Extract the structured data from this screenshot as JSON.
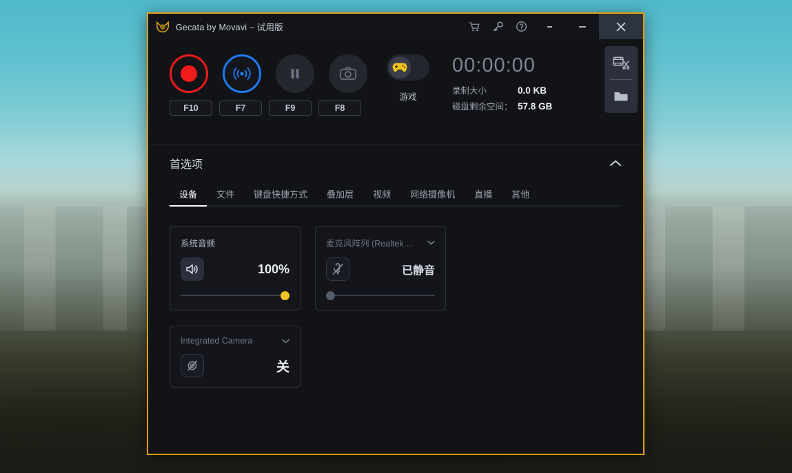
{
  "window": {
    "title": "Gecata by Movavi – 试用版",
    "logo_icon": "gecata-cat-logo-icon",
    "accent_border": "#e5a00d",
    "titlebar_icons": [
      {
        "name": "cart-icon",
        "glyph": "cart"
      },
      {
        "name": "key-icon",
        "glyph": "key"
      },
      {
        "name": "help-icon",
        "glyph": "question-circle"
      }
    ],
    "controls": {
      "collapse_to_tray_label": "-",
      "minimize_label": "—",
      "close_label": "✕"
    }
  },
  "toolbar": {
    "record": {
      "name": "record-button",
      "hotkey": "F10",
      "state": "idle",
      "color": "#f01b1b"
    },
    "stream": {
      "name": "stream-button",
      "hotkey": "F7",
      "state": "idle",
      "color": "#1b7cf5"
    },
    "pause": {
      "name": "pause-button",
      "hotkey": "F9",
      "state": "disabled"
    },
    "screenshot": {
      "name": "screenshot-button",
      "hotkey": "F8",
      "state": "disabled"
    },
    "game_toggle": {
      "label": "游戏",
      "state": "off",
      "icon": "gamepad-icon",
      "icon_color": "#f5c518"
    }
  },
  "status": {
    "timer": "00:00:00",
    "recording_size_label": "录制大小",
    "recording_size_value": "0.0 KB",
    "disk_space_label": "磁盘剩余空间：",
    "disk_space_value": "57.8 GB"
  },
  "side_rail": {
    "items": [
      {
        "name": "video-editor-button",
        "icon": "film-scissors-icon"
      },
      {
        "name": "open-folder-button",
        "icon": "folder-icon"
      }
    ]
  },
  "preferences": {
    "title": "首选项",
    "collapse_icon": "chevron-up-icon",
    "tabs": [
      {
        "label": "设备",
        "active": true
      },
      {
        "label": "文件",
        "active": false
      },
      {
        "label": "键盘快捷方式",
        "active": false
      },
      {
        "label": "叠加层",
        "active": false
      },
      {
        "label": "视频",
        "active": false
      },
      {
        "label": "网络摄像机",
        "active": false
      },
      {
        "label": "直播",
        "active": false
      },
      {
        "label": "其他",
        "active": false
      }
    ],
    "cards": {
      "system_audio": {
        "title": "系统音频",
        "icon": "speaker-on-icon",
        "value": "100%",
        "slider_percent": 100,
        "enabled": true
      },
      "microphone": {
        "title": "麦克风阵列 (Realtek ...",
        "icon": "microphone-muted-icon",
        "value": "已静音",
        "slider_percent": 0,
        "enabled": false,
        "has_dropdown": true
      },
      "camera": {
        "title": "Integrated Camera",
        "icon": "camera-off-icon",
        "value": "关",
        "enabled": false,
        "has_dropdown": true
      }
    }
  }
}
